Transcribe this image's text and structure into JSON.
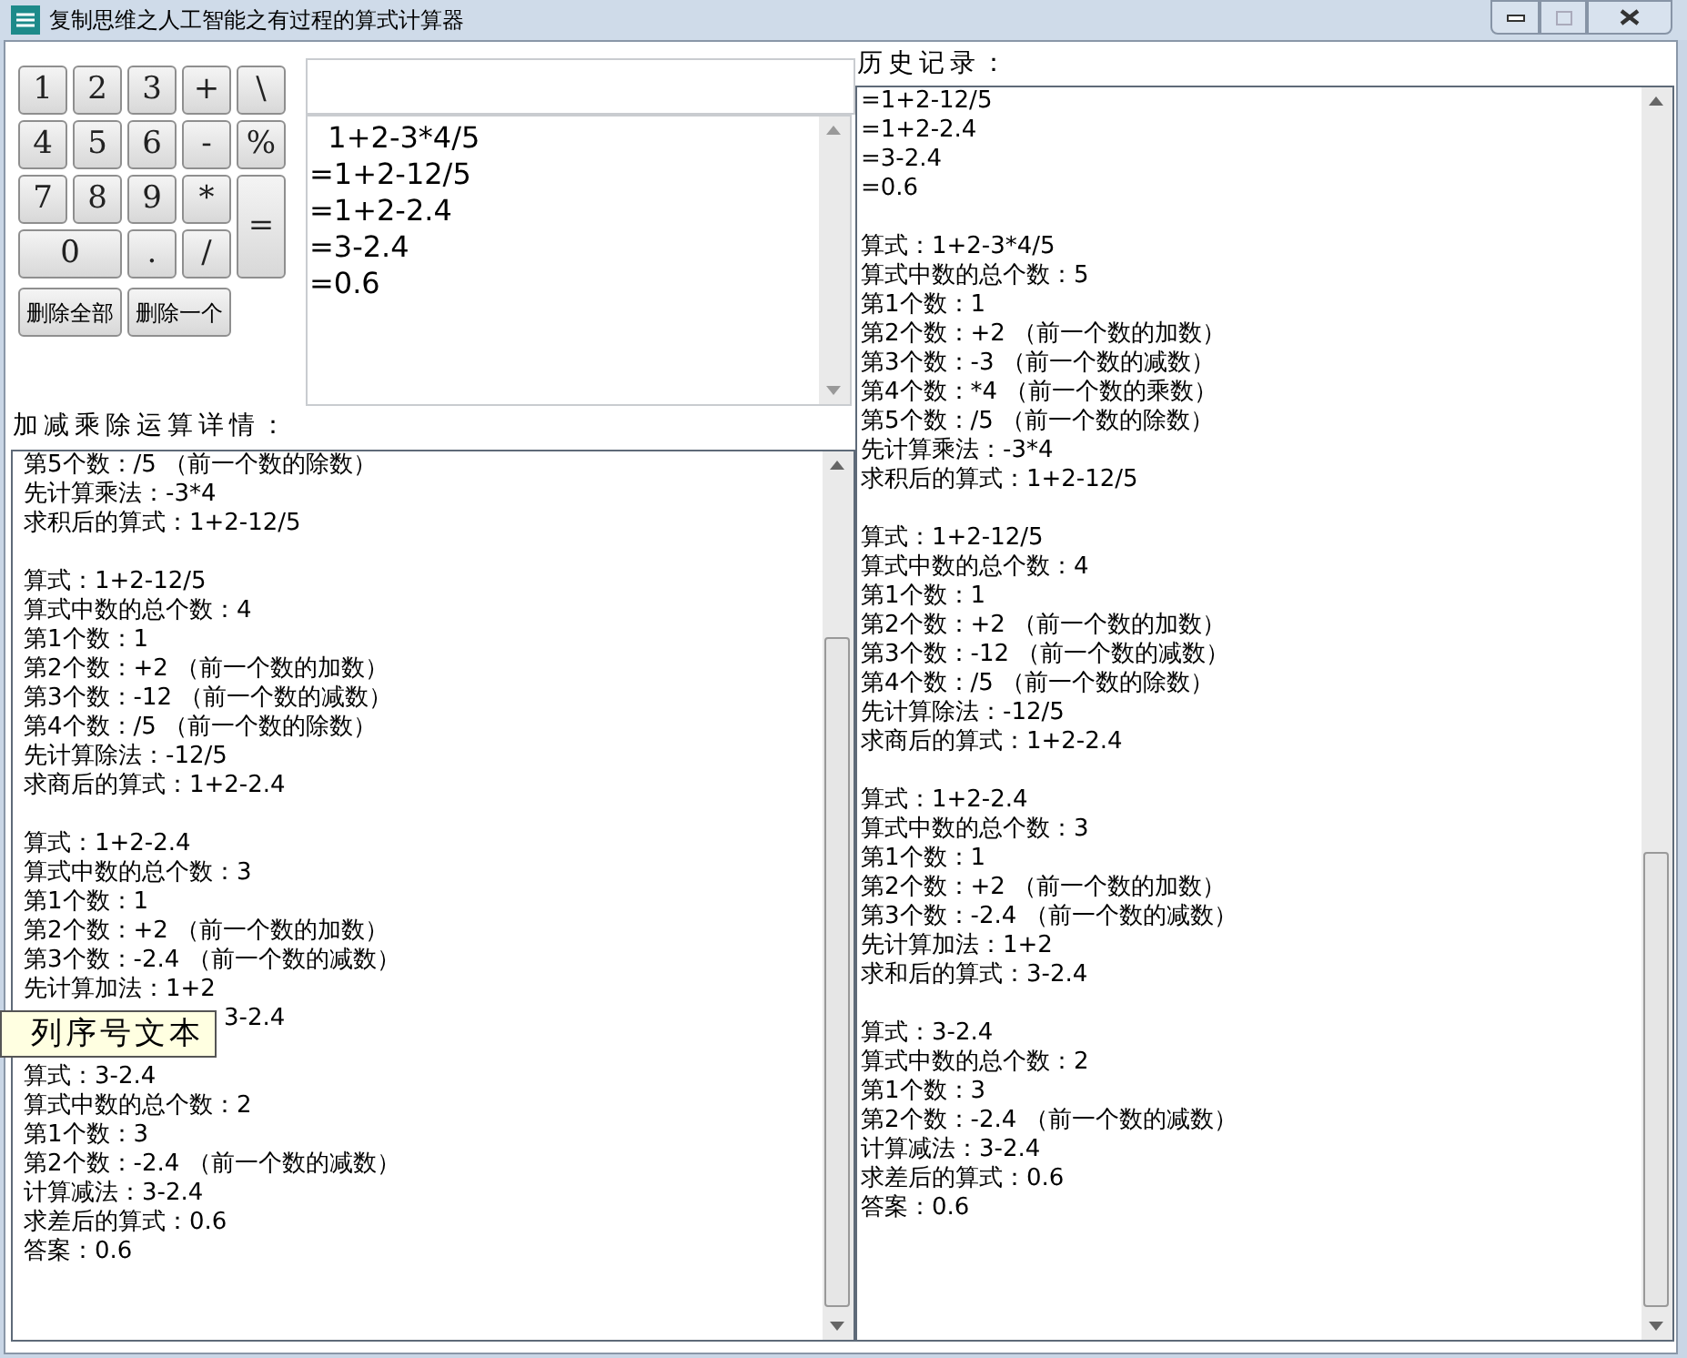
{
  "window": {
    "title": "复制思维之人工智能之有过程的算式计算器"
  },
  "title_controls": [
    {
      "kind": "minimize",
      "disabled": false
    },
    {
      "kind": "maximize",
      "disabled": true
    },
    {
      "kind": "close",
      "disabled": false
    }
  ],
  "keypad": [
    {
      "label": "1",
      "kind": "normal"
    },
    {
      "label": "2",
      "kind": "normal"
    },
    {
      "label": "3",
      "kind": "normal"
    },
    {
      "label": "+",
      "kind": "normal"
    },
    {
      "label": "\\",
      "kind": "normal"
    },
    {
      "label": "4",
      "kind": "normal"
    },
    {
      "label": "5",
      "kind": "normal"
    },
    {
      "label": "6",
      "kind": "normal"
    },
    {
      "label": "-",
      "kind": "normal"
    },
    {
      "label": "%",
      "kind": "normal"
    },
    {
      "label": "7",
      "kind": "normal"
    },
    {
      "label": "8",
      "kind": "normal"
    },
    {
      "label": "9",
      "kind": "normal"
    },
    {
      "label": "*",
      "kind": "normal"
    },
    {
      "label": "=",
      "kind": "tall"
    },
    {
      "label": "0",
      "kind": "wide"
    },
    {
      "label": ".",
      "kind": "normal"
    },
    {
      "label": "/",
      "kind": "normal"
    }
  ],
  "delete_buttons": [
    "删除全部",
    "删除一个"
  ],
  "result_lines": [
    "  1+2-3*4/5",
    "=1+2-12/5",
    "=1+2-2.4",
    "=3-2.4",
    "=0.6"
  ],
  "details": {
    "label": "加减乘除运算详情：",
    "blocks": [
      {
        "lines": [
          "第5个数：/5 （前一个数的除数）",
          "先计算乘法：-3*4",
          "求积后的算式：1+2-12/5"
        ]
      },
      {
        "lines": [
          "算式：1+2-12/5",
          "算式中数的总个数：4",
          "第1个数：1",
          "第2个数：+2 （前一个数的加数）",
          "第3个数：-12 （前一个数的减数）",
          "第4个数：/5 （前一个数的除数）",
          "先计算除法：-12/5",
          "求商后的算式：1+2-2.4"
        ]
      },
      {
        "lines": [
          "算式：1+2-2.4",
          "算式中数的总个数：3",
          "第1个数：1",
          "第2个数：+2 （前一个数的加数）",
          "第3个数：-2.4 （前一个数的减数）",
          "先计算加法：1+2"
        ],
        "covered_line": "3-2.4"
      },
      {
        "lines": [
          "算式：3-2.4",
          "算式中数的总个数：2",
          "第1个数：3",
          "第2个数：-2.4 （前一个数的减数）",
          "计算减法：3-2.4",
          "求差后的算式：0.6",
          "答案：0.6"
        ]
      }
    ]
  },
  "tooltip": {
    "text": "列序号文本"
  },
  "history": {
    "label": "历史记录：",
    "blocks": [
      {
        "lines": [
          "=1+2-12/5",
          "=1+2-2.4",
          "=3-2.4",
          "=0.6"
        ]
      },
      {
        "lines": [
          "算式：1+2-3*4/5",
          "算式中数的总个数：5",
          "第1个数：1",
          "第2个数：+2 （前一个数的加数）",
          "第3个数：-3 （前一个数的减数）",
          "第4个数：*4 （前一个数的乘数）",
          "第5个数：/5 （前一个数的除数）",
          "先计算乘法：-3*4",
          "求积后的算式：1+2-12/5"
        ]
      },
      {
        "lines": [
          "算式：1+2-12/5",
          "算式中数的总个数：4",
          "第1个数：1",
          "第2个数：+2 （前一个数的加数）",
          "第3个数：-12 （前一个数的减数）",
          "第4个数：/5 （前一个数的除数）",
          "先计算除法：-12/5",
          "求商后的算式：1+2-2.4"
        ]
      },
      {
        "lines": [
          "算式：1+2-2.4",
          "算式中数的总个数：3",
          "第1个数：1",
          "第2个数：+2 （前一个数的加数）",
          "第3个数：-2.4 （前一个数的减数）",
          "先计算加法：1+2",
          "求和后的算式：3-2.4"
        ]
      },
      {
        "lines": [
          "算式：3-2.4",
          "算式中数的总个数：2",
          "第1个数：3",
          "第2个数：-2.4 （前一个数的减数）",
          "计算减法：3-2.4",
          "求差后的算式：0.6",
          "答案：0.6"
        ]
      }
    ]
  }
}
